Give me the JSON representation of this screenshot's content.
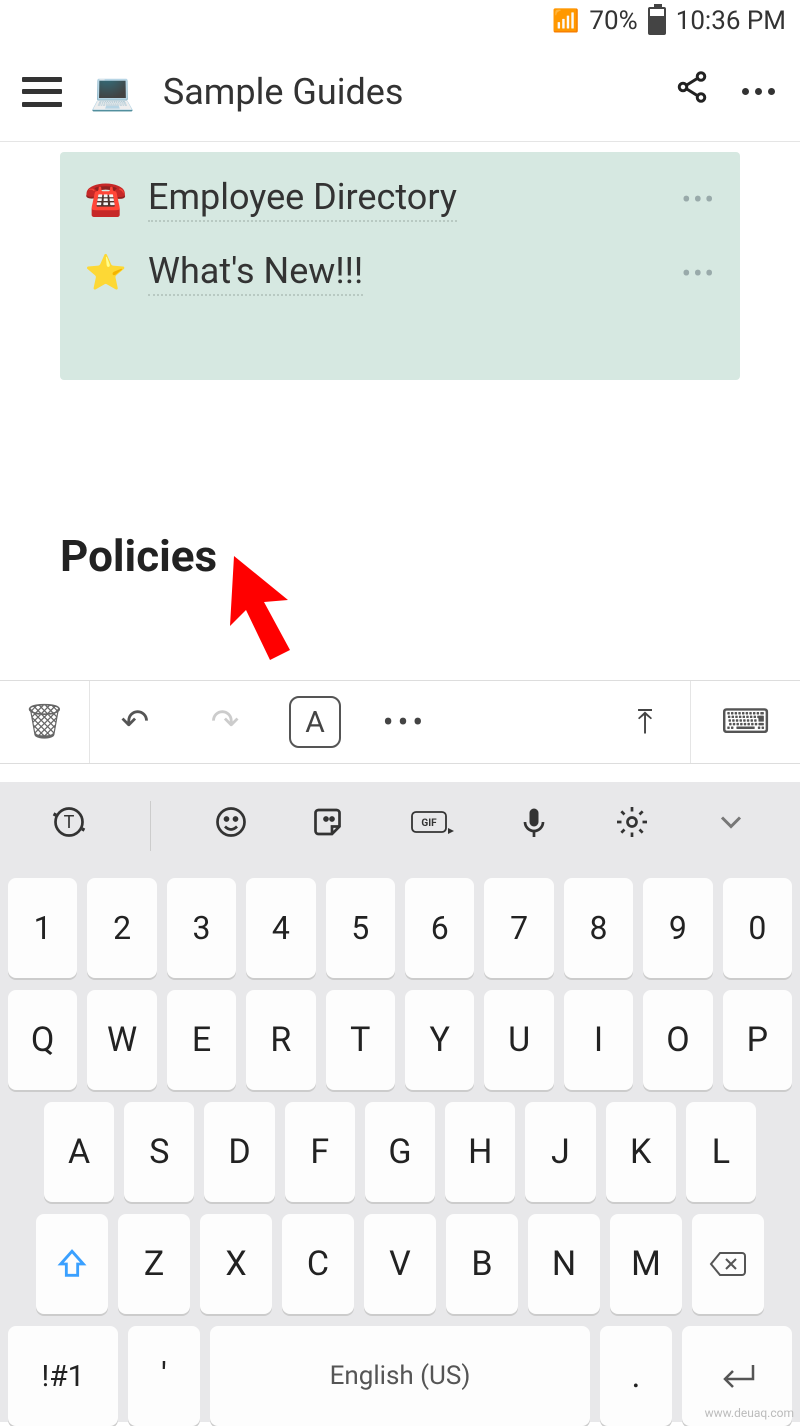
{
  "status": {
    "battery": "70%",
    "time": "10:36 PM"
  },
  "appbar": {
    "title": "Sample Guides"
  },
  "card": {
    "items": [
      {
        "emoji": "☎️",
        "label": "Employee Directory"
      },
      {
        "emoji": "⭐",
        "label": "What's New!!!"
      }
    ]
  },
  "heading": "Policies",
  "toolbar": {
    "aboxLabel": "A",
    "more": "•••"
  },
  "keyboard": {
    "nums": [
      "1",
      "2",
      "3",
      "4",
      "5",
      "6",
      "7",
      "8",
      "9",
      "0"
    ],
    "row1": [
      "Q",
      "W",
      "E",
      "R",
      "T",
      "Y",
      "U",
      "I",
      "O",
      "P"
    ],
    "row2": [
      "A",
      "S",
      "D",
      "F",
      "G",
      "H",
      "J",
      "K",
      "L"
    ],
    "row3": [
      "Z",
      "X",
      "C",
      "V",
      "B",
      "N",
      "M"
    ],
    "sym": "!#1",
    "apos": "'",
    "space": "English (US)",
    "dot": "."
  },
  "watermark": "www.deuaq.com"
}
